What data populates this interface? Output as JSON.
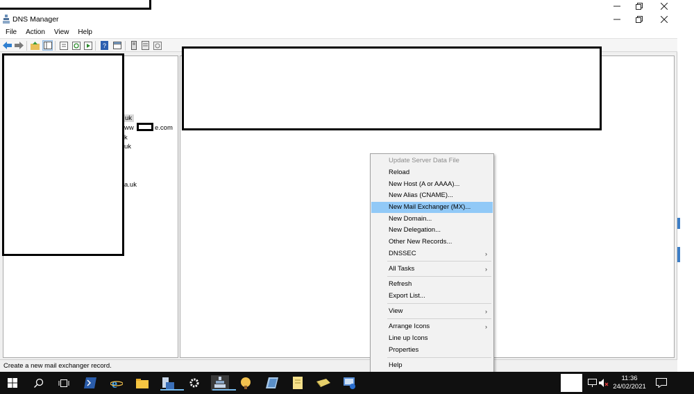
{
  "window": {
    "title": "DNS Manager",
    "menu": [
      "File",
      "Action",
      "View",
      "Help"
    ]
  },
  "tree": {
    "fragments": [
      "uk",
      "ww",
      "e.com",
      "k",
      "uk",
      "a.uk"
    ]
  },
  "context_menu": {
    "items": [
      {
        "label": "Update Server Data File",
        "disabled": true
      },
      {
        "label": "Reload"
      },
      {
        "label": "New Host (A or AAAA)..."
      },
      {
        "label": "New Alias (CNAME)..."
      },
      {
        "label": "New Mail Exchanger (MX)...",
        "highlighted": true
      },
      {
        "label": "New Domain..."
      },
      {
        "label": "New Delegation..."
      },
      {
        "label": "Other New Records..."
      },
      {
        "label": "DNSSEC",
        "submenu": true
      },
      {
        "label": "All Tasks",
        "submenu": true
      },
      {
        "label": "Refresh"
      },
      {
        "label": "Export List..."
      },
      {
        "label": "View",
        "submenu": true
      },
      {
        "label": "Arrange Icons",
        "submenu": true
      },
      {
        "label": "Line up Icons"
      },
      {
        "label": "Properties"
      },
      {
        "label": "Help"
      }
    ],
    "submenu_arrow": "›"
  },
  "status_bar": {
    "text": "Create a new mail exchanger record."
  },
  "taskbar": {
    "time": "11:36",
    "date": "24/02/2021",
    "icons": [
      "windows-start-icon",
      "search-icon",
      "task-view-icon",
      "powershell-icon",
      "internet-explorer-icon",
      "file-explorer-icon",
      "server-manager-icon",
      "settings-icon",
      "dns-manager-icon",
      "network-icon",
      "notepad-icon",
      "file-icon",
      "book-icon",
      "remote-desktop-icon"
    ]
  },
  "colors": {
    "highlight": "#91c9f7",
    "taskbar": "#101010",
    "active_line": "#76b9ed"
  }
}
